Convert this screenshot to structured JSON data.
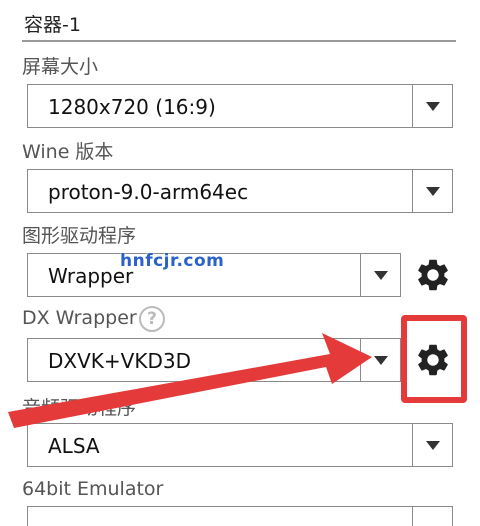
{
  "container": {
    "name": "容器-1"
  },
  "fields": [
    {
      "label": "屏幕大小",
      "value": "1280x720 (16:9)",
      "has_settings": false
    },
    {
      "label": "Wine 版本",
      "value": "proton-9.0-arm64ec",
      "has_settings": false
    },
    {
      "label": "图形驱动程序",
      "value": "Wrapper",
      "has_settings": true
    },
    {
      "label": "DX Wrapper",
      "value": "DXVK+VKD3D",
      "has_settings": true,
      "has_help": true
    },
    {
      "label": "音频驱动程序",
      "value": "ALSA",
      "has_settings": false
    },
    {
      "label": "64bit Emulator",
      "value": "",
      "has_settings": false
    }
  ],
  "help_glyph": "?",
  "watermark": "hnfcjr.com",
  "icons": {
    "dropdown": "triangle-down-icon",
    "settings": "gear-icon",
    "help": "question-circle-icon"
  },
  "colors": {
    "annotation_red": "#e53a3a",
    "watermark_blue": "#2a62c9"
  }
}
